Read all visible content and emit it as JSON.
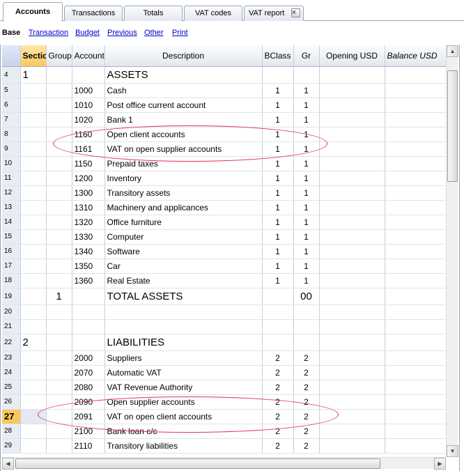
{
  "tabs": [
    {
      "label": "Accounts",
      "active": true
    },
    {
      "label": "Transactions"
    },
    {
      "label": "Totals"
    },
    {
      "label": "VAT codes"
    },
    {
      "label": "VAT report",
      "closable": true
    }
  ],
  "close_glyph": "×",
  "subtabs": [
    "Base",
    "Transaction",
    "Budget",
    "Previous",
    "Other",
    "Print"
  ],
  "columns": [
    "Section",
    "Group",
    "Account",
    "Description",
    "BClass",
    "Gr",
    "Opening USD",
    "Balance USD"
  ],
  "rows": [
    {
      "n": "4",
      "section": "1",
      "group": "",
      "account": "",
      "description": "ASSETS",
      "bclass": "",
      "gr": "",
      "style": "heading"
    },
    {
      "n": "5",
      "section": "",
      "group": "",
      "account": "1000",
      "description": "Cash",
      "bclass": "1",
      "gr": "1"
    },
    {
      "n": "6",
      "section": "",
      "group": "",
      "account": "1010",
      "description": "Post office current account",
      "bclass": "1",
      "gr": "1"
    },
    {
      "n": "7",
      "section": "",
      "group": "",
      "account": "1020",
      "description": "Bank 1",
      "bclass": "1",
      "gr": "1"
    },
    {
      "n": "8",
      "section": "",
      "group": "",
      "account": "1160",
      "description": "Open client accounts",
      "bclass": "1",
      "gr": "1"
    },
    {
      "n": "9",
      "section": "",
      "group": "",
      "account": "1161",
      "description": "VAT on open supplier accounts",
      "bclass": "1",
      "gr": "1"
    },
    {
      "n": "10",
      "section": "",
      "group": "",
      "account": "1150",
      "description": "Prepaid taxes",
      "bclass": "1",
      "gr": "1"
    },
    {
      "n": "11",
      "section": "",
      "group": "",
      "account": "1200",
      "description": "Inventory",
      "bclass": "1",
      "gr": "1"
    },
    {
      "n": "12",
      "section": "",
      "group": "",
      "account": "1300",
      "description": "Transitory assets",
      "bclass": "1",
      "gr": "1"
    },
    {
      "n": "13",
      "section": "",
      "group": "",
      "account": "1310",
      "description": "Machinery and applicances",
      "bclass": "1",
      "gr": "1"
    },
    {
      "n": "14",
      "section": "",
      "group": "",
      "account": "1320",
      "description": "Office furniture",
      "bclass": "1",
      "gr": "1"
    },
    {
      "n": "15",
      "section": "",
      "group": "",
      "account": "1330",
      "description": "Computer",
      "bclass": "1",
      "gr": "1"
    },
    {
      "n": "16",
      "section": "",
      "group": "",
      "account": "1340",
      "description": "Software",
      "bclass": "1",
      "gr": "1"
    },
    {
      "n": "17",
      "section": "",
      "group": "",
      "account": "1350",
      "description": "Car",
      "bclass": "1",
      "gr": "1"
    },
    {
      "n": "18",
      "section": "",
      "group": "",
      "account": "1360",
      "description": "Real Estate",
      "bclass": "1",
      "gr": "1"
    },
    {
      "n": "19",
      "section": "",
      "group": "1",
      "account": "",
      "description": "TOTAL ASSETS",
      "bclass": "",
      "gr": "00",
      "style": "heading"
    },
    {
      "n": "20",
      "section": "",
      "group": "",
      "account": "",
      "description": "",
      "bclass": "",
      "gr": ""
    },
    {
      "n": "21",
      "section": "",
      "group": "",
      "account": "",
      "description": "",
      "bclass": "",
      "gr": ""
    },
    {
      "n": "22",
      "section": "2",
      "group": "",
      "account": "",
      "description": "LIABILITIES",
      "bclass": "",
      "gr": "",
      "style": "heading"
    },
    {
      "n": "23",
      "section": "",
      "group": "",
      "account": "2000",
      "description": "Suppliers",
      "bclass": "2",
      "gr": "2"
    },
    {
      "n": "24",
      "section": "",
      "group": "",
      "account": "2070",
      "description": "Automatic VAT",
      "bclass": "2",
      "gr": "2"
    },
    {
      "n": "25",
      "section": "",
      "group": "",
      "account": "2080",
      "description": "VAT Revenue Authority",
      "bclass": "2",
      "gr": "2"
    },
    {
      "n": "26",
      "section": "",
      "group": "",
      "account": "2090",
      "description": "Open supplier accounts",
      "bclass": "2",
      "gr": "2"
    },
    {
      "n": "27",
      "section": "",
      "group": "",
      "account": "2091",
      "description": "VAT on open client accounts",
      "bclass": "2",
      "gr": "2",
      "current": true
    },
    {
      "n": "28",
      "section": "",
      "group": "",
      "account": "2100",
      "description": "Bank loan c/c",
      "bclass": "2",
      "gr": "2"
    },
    {
      "n": "29",
      "section": "",
      "group": "",
      "account": "2110",
      "description": "Transitory liabilities",
      "bclass": "2",
      "gr": "2"
    }
  ],
  "colors": {
    "highlight_ellipse": "#e0304f",
    "current_row": "#f8c85c",
    "link": "#0000cc"
  }
}
